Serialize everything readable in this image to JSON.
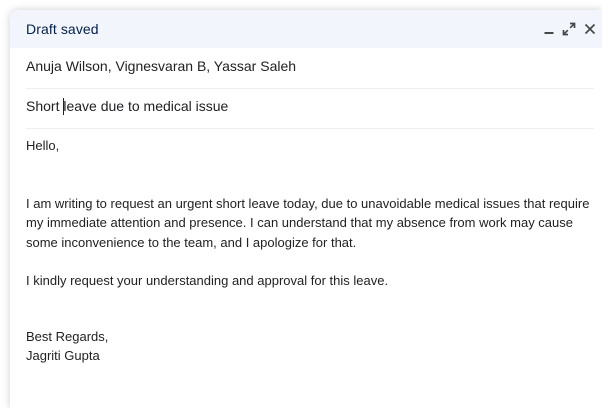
{
  "window": {
    "title": "Draft saved",
    "buttons": {
      "minimize_icon": "minimize-icon",
      "popout_icon": "expand-icon",
      "close_icon": "close-icon"
    }
  },
  "recipients": {
    "value": "Anuja Wilson, Vignesvaran B, Yassar Saleh"
  },
  "subject": {
    "before_caret": "Short ",
    "after_caret": "leave due to medical issue"
  },
  "body": {
    "greeting": "Hello,",
    "paragraph1": "I am writing to request an urgent short leave today,  due to unavoidable medical issues that require my immediate attention and presence. I can understand that my absence from work may cause some inconvenience to the team, and I apologize for that.",
    "paragraph2": "I kindly request your understanding and approval for this leave.",
    "signoff": "Best Regards,",
    "signature": "Jagriti Gupta"
  },
  "colors": {
    "header_bg": "#f2f6fc",
    "title_text": "#041e49",
    "body_text": "#222222"
  }
}
